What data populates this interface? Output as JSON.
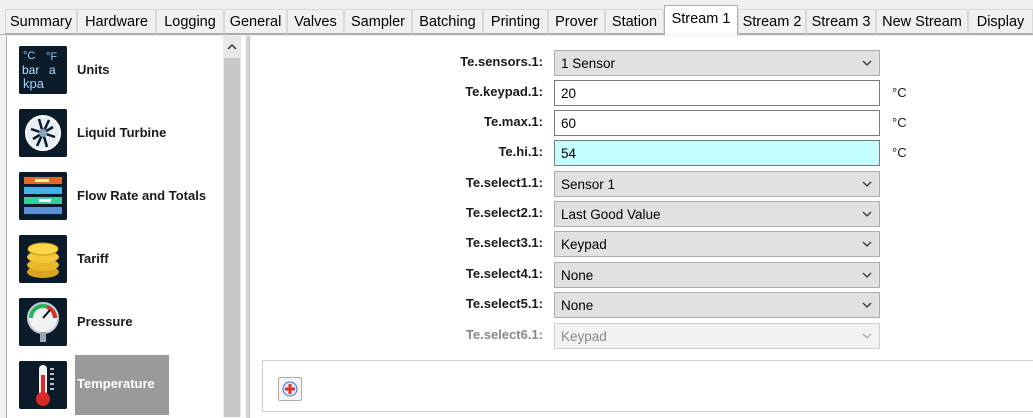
{
  "tabs": [
    {
      "label": "Summary"
    },
    {
      "label": "Hardware"
    },
    {
      "label": "Logging"
    },
    {
      "label": "General"
    },
    {
      "label": "Valves"
    },
    {
      "label": "Sampler"
    },
    {
      "label": "Batching"
    },
    {
      "label": "Printing"
    },
    {
      "label": "Prover"
    },
    {
      "label": "Station"
    },
    {
      "label": "Stream 1",
      "active": true
    },
    {
      "label": "Stream 2"
    },
    {
      "label": "Stream 3"
    },
    {
      "label": "New Stream"
    },
    {
      "label": "Display"
    }
  ],
  "sidebar": {
    "items": [
      {
        "label": "Units",
        "icon": "units-icon"
      },
      {
        "label": "Liquid Turbine",
        "icon": "turbine-icon"
      },
      {
        "label": "Flow Rate and Totals",
        "icon": "flow-rate-icon"
      },
      {
        "label": "Tariff",
        "icon": "coins-icon"
      },
      {
        "label": "Pressure",
        "icon": "pressure-gauge-icon"
      },
      {
        "label": "Temperature",
        "icon": "thermometer-icon",
        "active": true
      }
    ],
    "units_icon_text": {
      "degc": "°C",
      "f": "°F",
      "bar": "bar",
      "a": "a",
      "kpa": "kpa"
    }
  },
  "form": {
    "fields": [
      {
        "label": "Te.sensors.1:",
        "type": "select",
        "value": "1 Sensor"
      },
      {
        "label": "Te.keypad.1:",
        "type": "input",
        "value": "20",
        "unit": "°C"
      },
      {
        "label": "Te.max.1:",
        "type": "input",
        "value": "60",
        "unit": "°C"
      },
      {
        "label": "Te.hi.1:",
        "type": "input",
        "value": "54",
        "unit": "°C",
        "highlight": true
      },
      {
        "label": "Te.select1.1:",
        "type": "select",
        "value": "Sensor 1"
      },
      {
        "label": "Te.select2.1:",
        "type": "select",
        "value": "Last Good Value"
      },
      {
        "label": "Te.select3.1:",
        "type": "select",
        "value": "Keypad"
      },
      {
        "label": "Te.select4.1:",
        "type": "select",
        "value": "None"
      },
      {
        "label": "Te.select5.1:",
        "type": "select",
        "value": "None"
      },
      {
        "label": "Te.select6.1:",
        "type": "select",
        "value": "Keypad",
        "disabled": true
      }
    ]
  },
  "colors": {
    "highlight_input": "#c4ffff",
    "active_sidebar": "#9a9a9a",
    "add_icon_red": "#d9342b",
    "add_icon_blue": "#3a6fd8"
  },
  "add_button": {
    "icon": "add-icon"
  }
}
